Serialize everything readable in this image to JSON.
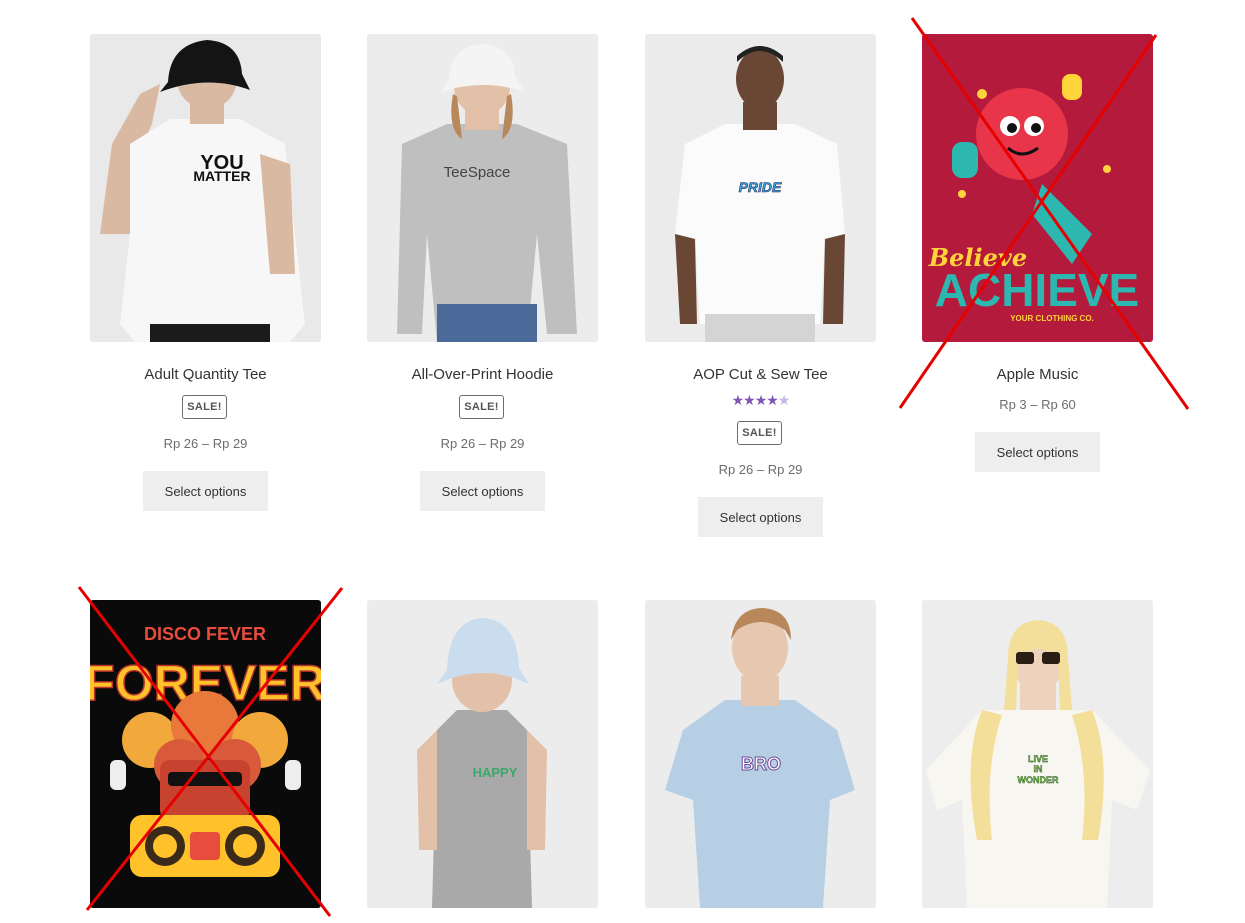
{
  "products": [
    {
      "title": "Adult Quantity Tee",
      "badge": "SALE!",
      "price": "Rp 26 – Rp 29",
      "button": "Select options",
      "image": {
        "type": "photo",
        "print_line1": "YOU",
        "print_line2": "MATTER"
      }
    },
    {
      "title": "All-Over-Print Hoodie",
      "badge": "SALE!",
      "price": "Rp 26 – Rp 29",
      "button": "Select options",
      "image": {
        "type": "photo",
        "print": "TeeSpace"
      }
    },
    {
      "title": "AOP Cut & Sew Tee",
      "badge": "SALE!",
      "price": "Rp 26 – Rp 29",
      "button": "Select options",
      "rating": {
        "value": 4.5,
        "max": 5
      },
      "image": {
        "type": "photo",
        "print": "PRIDE"
      }
    },
    {
      "title": "Apple Music",
      "price": "Rp 3 – Rp 60",
      "button": "Select options",
      "crossed_out": true,
      "image": {
        "type": "graphic",
        "line1": "Believe",
        "line2": "ACHIEVE",
        "line3": "YOUR CLOTHING CO."
      }
    },
    {
      "crossed_out": true,
      "image": {
        "type": "graphic",
        "line1": "DISCO FEVER",
        "line2": "FOREVER"
      }
    },
    {
      "image": {
        "type": "photo",
        "print": "HAPPY"
      }
    },
    {
      "image": {
        "type": "photo",
        "print": "BRO"
      }
    },
    {
      "image": {
        "type": "photo",
        "print_line1": "LIVE",
        "print_line2": "IN",
        "print_line3": "WONDER"
      }
    }
  ],
  "icons": {
    "star": "star-icon",
    "cross": "cross-out-mark"
  },
  "colors": {
    "rating": "#7f54b3",
    "button_bg": "#eeeeee",
    "cross": "#e60000"
  }
}
